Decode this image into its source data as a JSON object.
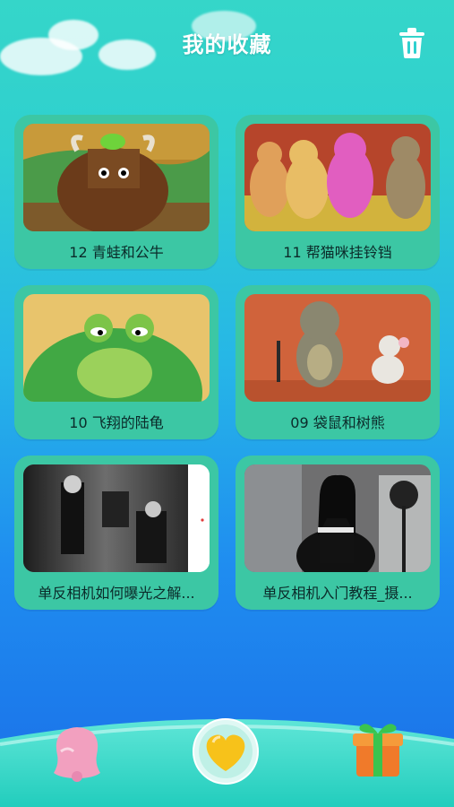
{
  "header": {
    "title": "我的收藏"
  },
  "favorites": [
    {
      "title": "12 青蛙和公牛"
    },
    {
      "title": "11 帮猫咪挂铃铛"
    },
    {
      "title": "10 飞翔的陆龟"
    },
    {
      "title": "09 袋鼠和树熊"
    },
    {
      "title": "单反相机如何曝光之解..."
    },
    {
      "title": "单反相机入门教程_摄..."
    }
  ],
  "icons": {
    "delete": "trash-icon",
    "left_nav": "bell-icon",
    "center_nav": "heart-icon",
    "right_nav": "gift-icon"
  },
  "colors": {
    "card": "#3cc7a4",
    "accent": "#f7c21a"
  }
}
